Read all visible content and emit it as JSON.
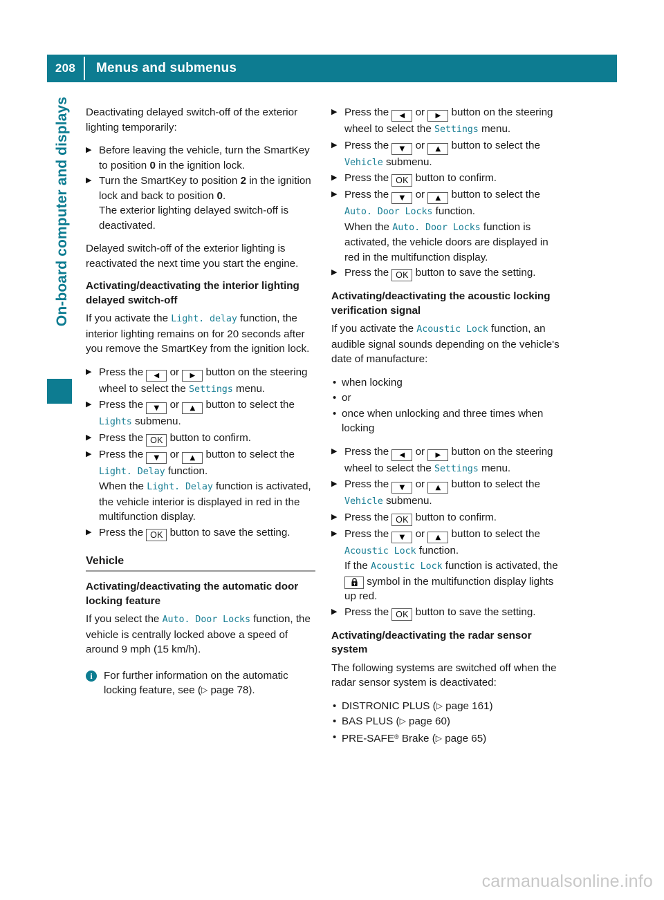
{
  "header": {
    "page_number": "208",
    "title": "Menus and submenus"
  },
  "sidebar": {
    "chapter_label": "On-board computer and displays"
  },
  "colors": {
    "accent_teal": "#0d7c91",
    "mono_text": "#1a7f95",
    "rule_gray": "#999999",
    "watermark_gray": "#c8c8c8"
  },
  "keycaps": {
    "left": "◀",
    "right": "▶",
    "down": "▼",
    "up": "▲",
    "ok": "OK"
  },
  "left_column": {
    "intro": "Deactivating delayed switch-off of the exterior lighting temporarily:",
    "intro_steps": [
      {
        "pre": "Before leaving the vehicle, turn the SmartKey to position ",
        "bold": "0",
        "post": " in the ignition lock."
      },
      {
        "pre": "Turn the SmartKey to position ",
        "bold": "2",
        "mid": " in the ignition lock and back to position ",
        "bold2": "0",
        "post": ".",
        "extra": "The exterior lighting delayed switch-off is deactivated."
      }
    ],
    "reactivate_para": "Delayed switch-off of the exterior lighting is reactivated the next time you start the engine.",
    "interior_heading": "Activating/deactivating the interior lighting delayed switch-off",
    "interior_intro_a": "If you activate the ",
    "interior_intro_fn": "Light. delay",
    "interior_intro_b": " function, the interior lighting remains on for 20 seconds after you remove the SmartKey from the ignition lock.",
    "step_press_the": "Press the ",
    "step_or": " or ",
    "step_button_steering": " button on the steering wheel to select the ",
    "menu_settings": "Settings",
    "step_menu_word": " menu.",
    "step_button_select": " button to select the ",
    "submenu_lights": "Lights",
    "step_submenu_word": " submenu.",
    "step_ok_confirm": " button to confirm.",
    "fn_light_delay": "Light. Delay",
    "step_function_word": " function.",
    "when_the": "When the ",
    "when_the_tail": " function is activated, the vehicle interior is displayed in red in the multifunction display.",
    "step_ok_save": " button to save the setting.",
    "vehicle_section": "Vehicle",
    "auto_door_heading": "Activating/deactivating the automatic door locking feature",
    "auto_door_intro_a": "If you select the ",
    "auto_door_fn": "Auto. Door Locks",
    "auto_door_intro_b": " function, the vehicle is centrally locked above a speed of around 9 mph (15 km/h).",
    "note_text_a": "For further information on the automatic locking feature, see (",
    "note_xref": "▷",
    "note_text_b": " page 78)."
  },
  "right_column": {
    "step_press_the": "Press the ",
    "step_or": " or ",
    "step_button_steering": " button on the steering wheel to select the ",
    "menu_settings": "Settings",
    "step_menu_word": " menu.",
    "step_button_select": " button to select the ",
    "submenu_vehicle": "Vehicle",
    "step_submenu_word": " submenu.",
    "step_ok_confirm": " button to confirm.",
    "fn_auto_door_locks": "Auto. Door Locks",
    "step_function_word": " function.",
    "when_the": "When the ",
    "when_the_tail": " function is activated, the vehicle doors are displayed in red in the multifunction display.",
    "step_ok_save": " button to save the setting.",
    "acoustic_heading": "Activating/deactivating the acoustic locking verification signal",
    "acoustic_intro_a": "If you activate the ",
    "acoustic_fn": "Acoustic Lock",
    "acoustic_intro_b": " function, an audible signal sounds depending on the vehicle's date of manufacture:",
    "acoustic_bullets": [
      "when locking",
      "or",
      "once when unlocking and three times when locking"
    ],
    "if_the": "If the ",
    "if_the_tail_a": " function is activated, the ",
    "if_the_tail_b": " symbol in the multifunction display lights up red.",
    "radar_heading": "Activating/deactivating the radar sensor system",
    "radar_intro": "The following systems are switched off when the radar sensor system is deactivated:",
    "radar_items": [
      {
        "name": "DISTRONIC PLUS",
        "xref": "▷",
        "page": " page 161)"
      },
      {
        "name": "BAS PLUS",
        "xref": "▷",
        "page": " page 60)"
      },
      {
        "name": "PRE-SAFE",
        "reg": "®",
        "suffix": " Brake",
        "xref": "▷",
        "page": " page 65)"
      }
    ]
  },
  "footer": {
    "watermark": "carmanualsonline.info"
  }
}
